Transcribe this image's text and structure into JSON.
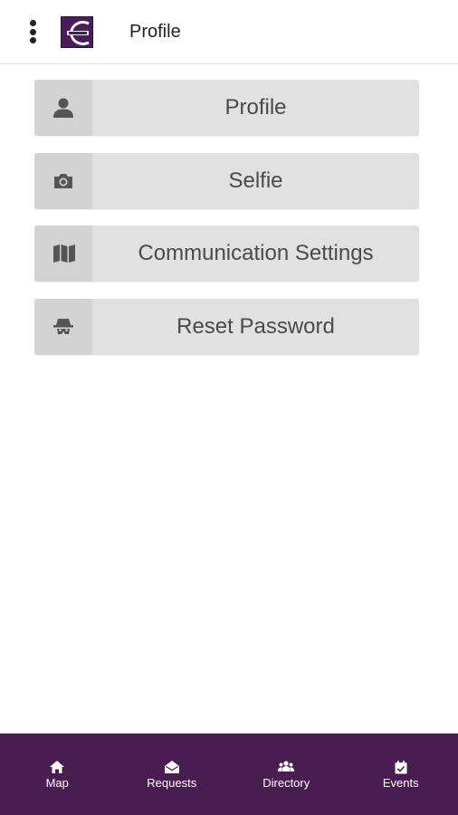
{
  "header": {
    "title": "Profile",
    "menu_icon": "kebab-menu-icon",
    "logo_icon": "app-logo"
  },
  "menu": {
    "items": [
      {
        "label": "Profile",
        "icon": "user-icon"
      },
      {
        "label": "Selfie",
        "icon": "camera-icon"
      },
      {
        "label": "Communication Settings",
        "icon": "map-icon"
      },
      {
        "label": "Reset Password",
        "icon": "incognito-icon"
      }
    ]
  },
  "tabbar": {
    "items": [
      {
        "label": "Map",
        "icon": "home-icon"
      },
      {
        "label": "Requests",
        "icon": "envelope-open-icon"
      },
      {
        "label": "Directory",
        "icon": "users-icon"
      },
      {
        "label": "Events",
        "icon": "calendar-check-icon"
      }
    ]
  },
  "colors": {
    "brand": "#4a1d52",
    "button_bg": "#e1e1e1",
    "icon_bg": "#d3d3d3",
    "text": "#4a4a4a"
  }
}
